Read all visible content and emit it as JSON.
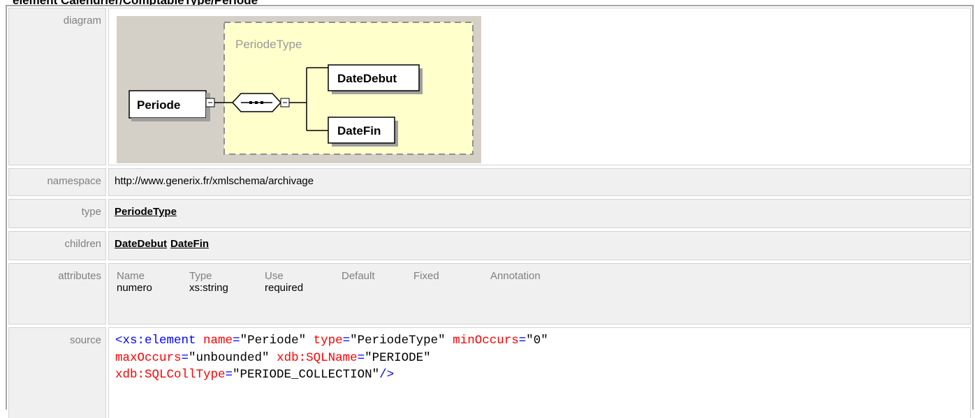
{
  "title": "element Calendrier/ComptableType/Periode",
  "labels": {
    "diagram": "diagram",
    "namespace": "namespace",
    "type": "type",
    "children": "children",
    "attributes": "attributes",
    "source": "source"
  },
  "diagram": {
    "group_label": "PeriodeType",
    "element": "Periode",
    "children": [
      "DateDebut",
      "DateFin"
    ]
  },
  "namespace": "http://www.generix.fr/xmlschema/archivage",
  "type": "PeriodeType",
  "children": [
    "DateDebut",
    "DateFin"
  ],
  "attributes": {
    "headers": [
      "Name",
      "Type",
      "Use",
      "Default",
      "Fixed",
      "Annotation"
    ],
    "rows": [
      [
        "numero",
        "xs:string",
        "required",
        "",
        "",
        ""
      ]
    ]
  },
  "source": {
    "line1": {
      "tag": "<xs:element",
      "a1": "name",
      "v1": "\"Periode\"",
      "a2": "type",
      "v2": "\"PeriodeType\"",
      "a3": "minOccurs",
      "v3": "\"0\""
    },
    "line2": {
      "a1": "maxOccurs",
      "v1": "\"unbounded\"",
      "a2": "xdb:SQLName",
      "v2": "\"PERIODE\""
    },
    "line3": {
      "a1": "xdb:SQLCollType",
      "v1": "\"PERIODE_COLLECTION\"",
      "end": "/>"
    },
    "eq": "="
  },
  "colors": {
    "label_bg": "#f0f0f0",
    "diagram_bg": "#d4d0c8",
    "group_fill": "#ffffcc",
    "tag": "#0000ff",
    "attr_name": "#ff0000"
  }
}
